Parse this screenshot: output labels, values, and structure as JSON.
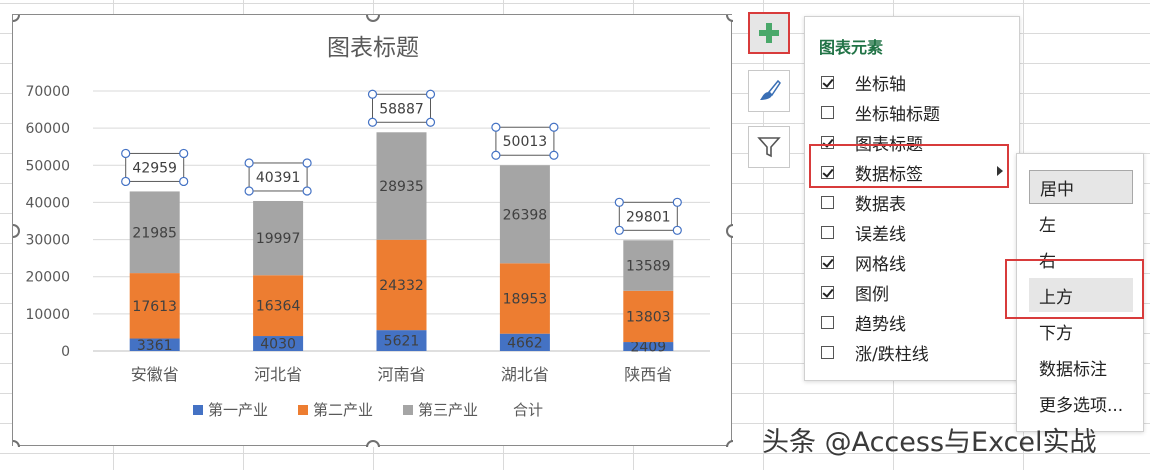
{
  "chart_data": {
    "type": "bar",
    "stacked": true,
    "title": "图表标题",
    "categories": [
      "安徽省",
      "河北省",
      "河南省",
      "湖北省",
      "陕西省"
    ],
    "series": [
      {
        "name": "第一产业",
        "values": [
          3361,
          4030,
          5621,
          4662,
          2409
        ],
        "color": "#4472c4"
      },
      {
        "name": "第二产业",
        "values": [
          17613,
          16364,
          24332,
          18953,
          13803
        ],
        "color": "#ed7d31"
      },
      {
        "name": "第三产业",
        "values": [
          21985,
          19997,
          28935,
          26398,
          13589
        ],
        "color": "#a5a5a5"
      }
    ],
    "totals": {
      "name": "合计",
      "values": [
        42959,
        40391,
        58887,
        50013,
        29801
      ]
    },
    "ylim": [
      0,
      70000
    ],
    "yticks": [
      0,
      10000,
      20000,
      30000,
      40000,
      50000,
      60000,
      70000
    ],
    "ytick_labels": [
      "0",
      "10000",
      "20000",
      "30000",
      "40000",
      "50000",
      "60000",
      "70000"
    ],
    "grid": true,
    "legend_position": "bottom"
  },
  "side_buttons": {
    "plus_icon": "plus-icon",
    "brush_icon": "paintbrush-icon",
    "filter_icon": "filter-icon"
  },
  "chart_elements_panel": {
    "title": "图表元素",
    "items": [
      {
        "label": "坐标轴",
        "checked": true
      },
      {
        "label": "坐标轴标题",
        "checked": false
      },
      {
        "label": "图表标题",
        "checked": true
      },
      {
        "label": "数据标签",
        "checked": true,
        "has_submenu": true
      },
      {
        "label": "数据表",
        "checked": false
      },
      {
        "label": "误差线",
        "checked": false
      },
      {
        "label": "网格线",
        "checked": true
      },
      {
        "label": "图例",
        "checked": true
      },
      {
        "label": "趋势线",
        "checked": false
      },
      {
        "label": "涨/跌柱线",
        "checked": false
      }
    ]
  },
  "data_label_submenu": {
    "items": [
      {
        "label": "居中",
        "selected": true
      },
      {
        "label": "左"
      },
      {
        "label": "右"
      },
      {
        "label": "上方",
        "hovered": true
      },
      {
        "label": "下方"
      },
      {
        "label": "数据标注"
      },
      {
        "label": "更多选项..."
      }
    ]
  },
  "watermark": "头条 @Access与Excel实战",
  "colors": {
    "accent_green": "#217346",
    "highlight_red": "#d83b3b",
    "handle_blue": "#4472c4"
  }
}
